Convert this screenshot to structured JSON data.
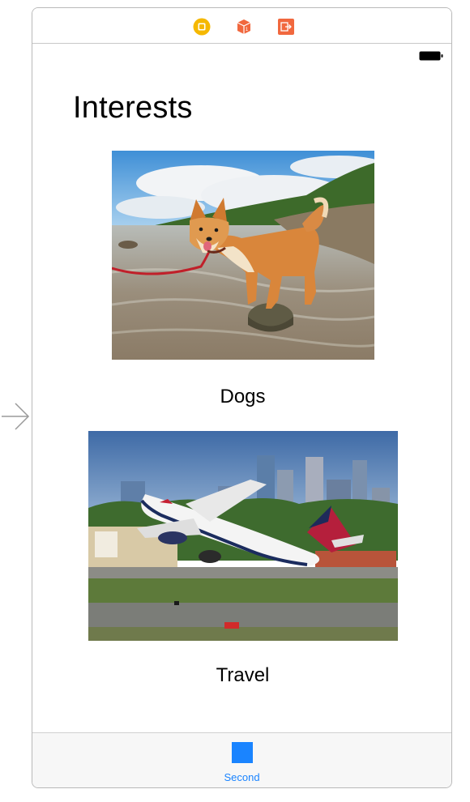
{
  "storyboard": {
    "dock_icons": [
      "view-controller-icon",
      "first-responder-icon",
      "exit-icon"
    ],
    "entry_point": "initial-view-controller-arrow-icon"
  },
  "status_bar": {
    "battery": "battery-icon"
  },
  "screen": {
    "title": "Interests",
    "items": [
      {
        "caption": "Dogs",
        "image": "shiba-inu-standing-on-rock-photo"
      },
      {
        "caption": "Travel",
        "image": "delta-airplane-takeoff-photo"
      }
    ]
  },
  "tab_bar": {
    "items": [
      {
        "label": "Second",
        "icon": "square-tab-icon"
      }
    ]
  },
  "colors": {
    "accent": "#1A84FF",
    "dock_vc": "#F5B800",
    "dock_fr": "#F1683E",
    "dock_exit": "#F1683E"
  }
}
